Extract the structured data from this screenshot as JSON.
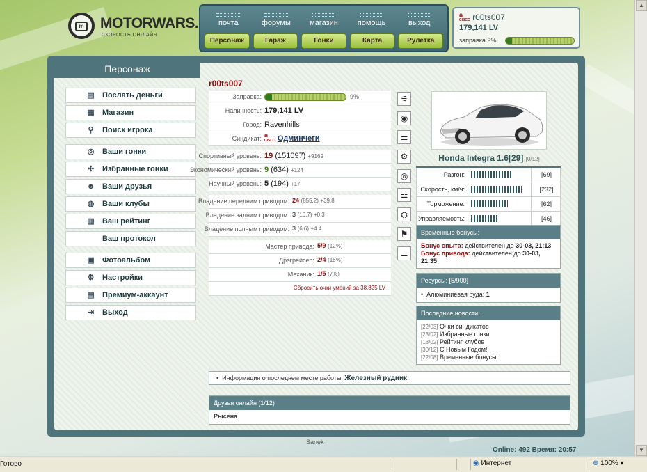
{
  "logo": {
    "name": "MOTORWARS.RU",
    "tagline": "СКОРОСТЬ ОН-ЛАЙН"
  },
  "topnav": {
    "row1": [
      "почта",
      "форумы",
      "магазин",
      "помощь",
      "выход"
    ],
    "row2": [
      "Персонаж",
      "Гараж",
      "Гонки",
      "Карта",
      "Рулетка"
    ]
  },
  "user": {
    "name": "r00ts007",
    "money": "179,141 LV",
    "fuel_label": "заправка 9%",
    "fuel_percent": 9,
    "logo_text": "CISCO"
  },
  "left": {
    "title": "Персонаж",
    "menu": [
      {
        "label": "Послать деньги",
        "icon": "money-icon",
        "glyph": "▤"
      },
      {
        "label": "Магазин",
        "icon": "shop-icon",
        "glyph": "▦"
      },
      {
        "label": "Поиск игрока",
        "icon": "search-icon",
        "glyph": "⚲"
      },
      {
        "label": "Ваши гонки",
        "icon": "steering-wheel-icon",
        "glyph": "◎"
      },
      {
        "label": "Избранные гонки",
        "icon": "favorite-races-icon",
        "glyph": "✣"
      },
      {
        "label": "Ваши друзья",
        "icon": "friends-icon",
        "glyph": "☻"
      },
      {
        "label": "Ваши клубы",
        "icon": "clubs-icon",
        "glyph": "◍"
      },
      {
        "label": "Ваш рейтинг",
        "icon": "rating-icon",
        "glyph": "▥"
      },
      {
        "label": "Ваш протокол",
        "icon": "",
        "glyph": ""
      },
      {
        "label": "Фотоальбом",
        "icon": "photo-album-icon",
        "glyph": "▣"
      },
      {
        "label": "Настройки",
        "icon": "settings-icon",
        "glyph": "⚙"
      },
      {
        "label": "Премиум-аккаунт",
        "icon": "premium-icon",
        "glyph": "▤"
      },
      {
        "label": "Выход",
        "icon": "exit-icon",
        "glyph": "⇥"
      }
    ]
  },
  "char": {
    "name": "r00ts007",
    "fuel": {
      "label": "Заправка:",
      "percent": 9,
      "text": "9%"
    },
    "cash": {
      "label": "Наличность:",
      "value": "179,141 LV"
    },
    "city": {
      "label": "Город:",
      "value": "Ravenhills"
    },
    "syndicate": {
      "label": "Синдикат:",
      "value": "Одминчеги",
      "logo_text": "CISCO"
    },
    "sport": {
      "label": "Спортивный уровень:",
      "level": "19",
      "points": "(151097)",
      "bonus": "+9169"
    },
    "econ": {
      "label": "Экономический уровень:",
      "level": "9",
      "points": "(634)",
      "bonus": "+124"
    },
    "sci": {
      "label": "Научный уровень:",
      "level": "5",
      "points": "(194)",
      "bonus": "+17"
    },
    "fwd": {
      "label": "Владение передним приводом:",
      "level": "24",
      "points": "(855.2)",
      "bonus": "+39.8"
    },
    "rwd": {
      "label": "Владение задним приводом:",
      "level": "3",
      "points": "(10.7)",
      "bonus": "+0.3"
    },
    "awd": {
      "label": "Владение полным приводом:",
      "level": "3",
      "points": "(6.6)",
      "bonus": "+4.4"
    },
    "drive_master": {
      "label": "Мастер привода:",
      "value": "5/9",
      "pct": "(12%)"
    },
    "drifter": {
      "label": "Дрэгрейсер:",
      "value": "2/4",
      "pct": "(18%)"
    },
    "mechanic": {
      "label": "Механик:",
      "value": "1/5",
      "pct": "(7%)"
    },
    "reset": "Сбросить очки умений за 38.825 LV"
  },
  "icons": [
    "suspension-icon",
    "tire-icon",
    "exhaust-icon",
    "engine-icon",
    "turbo-icon",
    "gearbox-icon",
    "transmission-icon",
    "seat-icon",
    "spoiler-icon"
  ],
  "car": {
    "name": "Honda Integra 1.6[29]",
    "slots": "[0/12]",
    "stats": [
      {
        "label": "Разгон:",
        "value": "[69]",
        "level": 69
      },
      {
        "label": "Скорость, км/ч:",
        "value": "[232]",
        "level": 85
      },
      {
        "label": "Торможение:",
        "value": "[62]",
        "level": 62
      },
      {
        "label": "Управляемость:",
        "value": "[46]",
        "level": 46
      }
    ]
  },
  "bonuses": {
    "title": "Временные бонусы:",
    "exp_label": "Бонус опыта:",
    "exp_text": "действителен до",
    "exp_date": "30-03, 21:13",
    "drive_label": "Бонус привода:",
    "drive_text": "действителен до",
    "drive_date": "30-03, 21:35"
  },
  "resources": {
    "title": "Ресурсы: [5/900]",
    "item_label": "Алюминиевая руда:",
    "item_value": "1"
  },
  "news": {
    "title": "Последние новости:",
    "items": [
      {
        "date": "[22/03]",
        "text": "Очки синдикатов"
      },
      {
        "date": "[23/02]",
        "text": "Избранные гонки"
      },
      {
        "date": "[13/02]",
        "text": "Рейтинг клубов"
      },
      {
        "date": "[30/12]",
        "text": "С Новым Годом!"
      },
      {
        "date": "[22/08]",
        "text": "Временные бонусы"
      }
    ]
  },
  "work": {
    "label": "Информация о последнем месте работы:",
    "value": "Железный рудник"
  },
  "friends": {
    "title": "Друзья онлайн (1/12)",
    "name": "Рысена"
  },
  "footer": {
    "signature": "Sanek",
    "online": "Online: 492  Время: 20:57"
  },
  "statusbar": {
    "status": "Готово",
    "zone": "Интернет",
    "zoom": "100%"
  },
  "colors": {
    "panel": "#4f747b",
    "accent_red": "#8a1010",
    "green": "#98c03a"
  }
}
